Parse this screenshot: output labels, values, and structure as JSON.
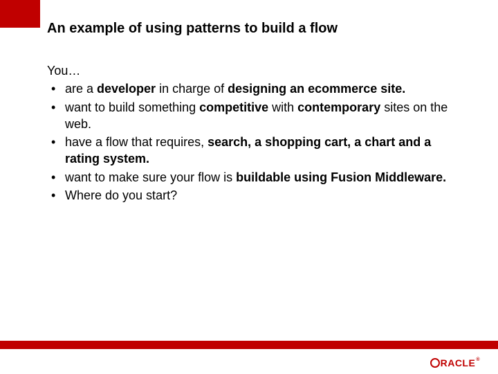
{
  "title": "An example of using patterns to build a flow",
  "intro": "You…",
  "bullets": [
    {
      "segments": [
        {
          "t": "are a ",
          "b": false
        },
        {
          "t": "developer",
          "b": true
        },
        {
          "t": " in charge of ",
          "b": false
        },
        {
          "t": "designing an ecommerce site.",
          "b": true
        }
      ]
    },
    {
      "segments": [
        {
          "t": "want to build something ",
          "b": false
        },
        {
          "t": "competitive",
          "b": true
        },
        {
          "t": " with ",
          "b": false
        },
        {
          "t": "contemporary",
          "b": true
        },
        {
          "t": " sites on the web.",
          "b": false
        }
      ]
    },
    {
      "segments": [
        {
          "t": "have a flow that requires, ",
          "b": false
        },
        {
          "t": "search, a shopping cart, a chart and a rating system.",
          "b": true
        }
      ]
    },
    {
      "segments": [
        {
          "t": "want to make sure your flow is ",
          "b": false
        },
        {
          "t": "buildable using Fusion Middleware.",
          "b": true
        }
      ]
    },
    {
      "segments": [
        {
          "t": "Where do you start?",
          "b": false
        }
      ]
    }
  ],
  "logo": {
    "text": "RACLE",
    "reg": "®"
  },
  "colors": {
    "brand_red": "#c00000"
  }
}
